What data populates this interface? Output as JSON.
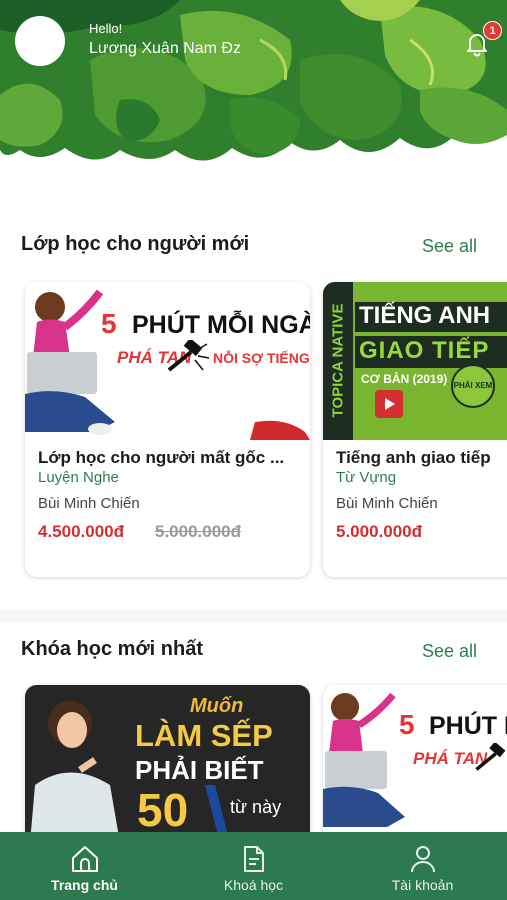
{
  "header": {
    "greeting": "Hello!",
    "user_name": "Lương Xuân Nam Đz",
    "notification_count": "1",
    "colors": {
      "leaf_dark": "#1e6b2a",
      "leaf_mid": "#3b8f2f",
      "leaf_light": "#74b83a"
    }
  },
  "section_new_learners": {
    "title": "Lớp học cho người mới",
    "see_all": "See all",
    "cards": [
      {
        "thumb_line1_prefix": "5",
        "thumb_line1": "PHÚT MỖI NGÀY",
        "thumb_line2": "PHÁ TAN",
        "thumb_line3": "NỖI SỢ TIẾNG ANH",
        "title": "Lớp học cho người mất gốc ...",
        "category": "Luyện Nghe",
        "author": "Bùi Minh Chiến",
        "price": "4.500.000đ",
        "old_price": "5.000.000đ"
      },
      {
        "thumb_side": "TOPICA NATIVE",
        "thumb_line1": "TIẾNG ANH",
        "thumb_line2": "GIAO TIẾP",
        "thumb_line3": "CƠ BẢN (2019)",
        "thumb_stamp": "PHẢI XEM",
        "title": "Tiếng anh giao tiếp",
        "category": "Từ Vựng",
        "author": "Bùi Minh Chiến",
        "price": "5.000.000đ"
      }
    ]
  },
  "section_latest": {
    "title": "Khóa học mới nhất",
    "see_all": "See all",
    "cards": [
      {
        "thumb_line1": "Muốn",
        "thumb_line2": "LÀM SẾP",
        "thumb_line3": "PHẢI BIẾT",
        "thumb_number": "50",
        "thumb_line4": "từ này"
      },
      {
        "thumb_line1_prefix": "5",
        "thumb_line1": "PHÚT M",
        "thumb_line2": "PHÁ TAN"
      }
    ]
  },
  "bottom_nav": {
    "items": [
      {
        "label": "Trang chủ",
        "icon": "home-icon",
        "active": true
      },
      {
        "label": "Khoá học",
        "icon": "document-icon",
        "active": false
      },
      {
        "label": "Tài khoản",
        "icon": "user-icon",
        "active": false
      }
    ],
    "color": "#2c7a4e"
  }
}
